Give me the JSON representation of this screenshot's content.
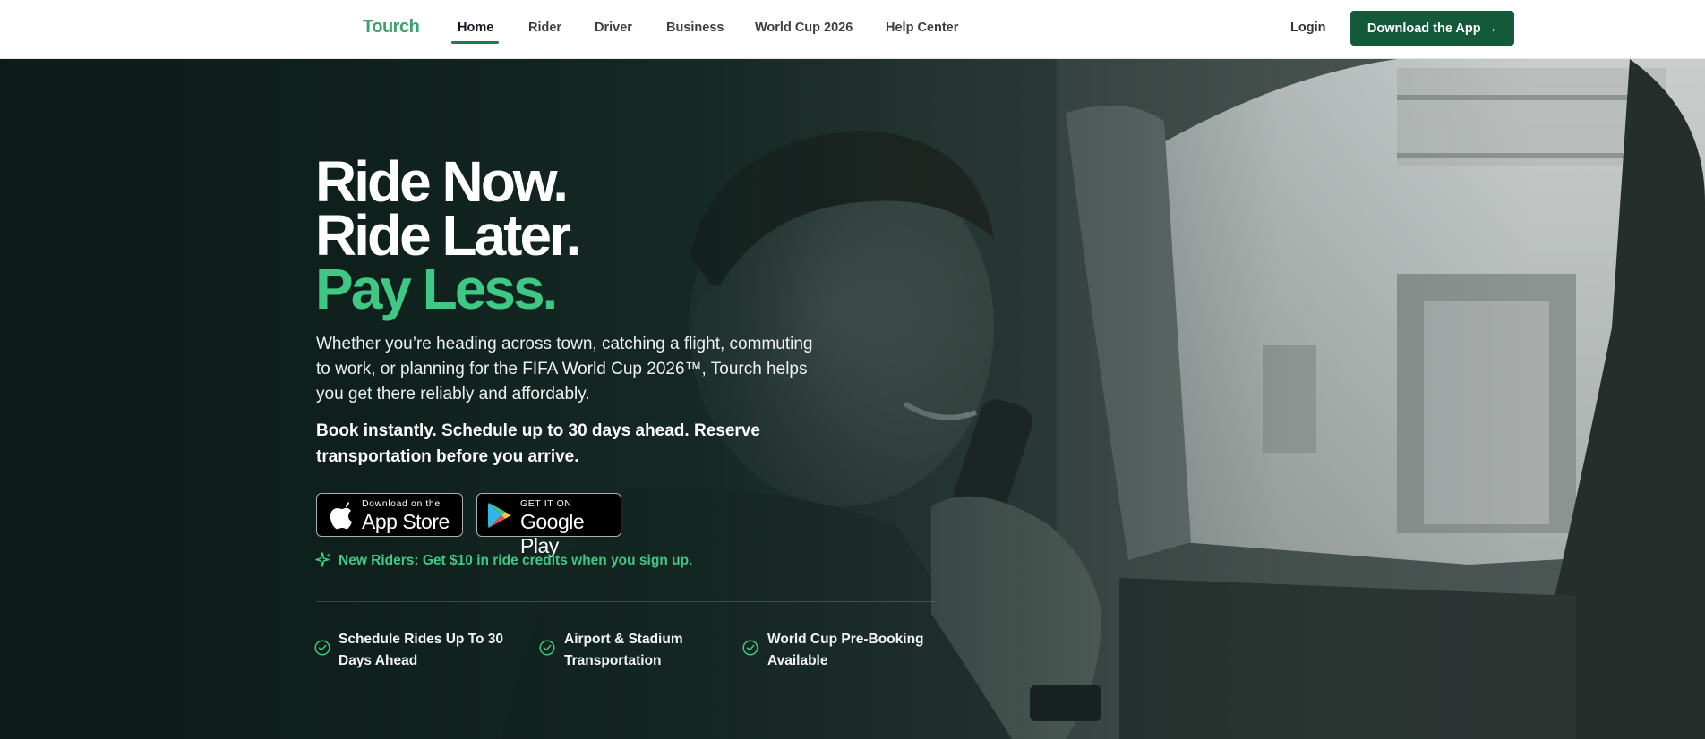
{
  "brand": {
    "logo": "Tourch"
  },
  "nav": {
    "links": [
      "Home",
      "Rider",
      "Driver",
      "Business",
      "World Cup 2026",
      "Help Center"
    ],
    "login": "Login",
    "cta": "Download the App →"
  },
  "hero": {
    "line1": "Ride Now.",
    "line2": "Ride Later.",
    "line3": "Pay Less.",
    "paragraph": "Whether you’re heading across town, catching a flight, commuting to work, or planning for the FIFA World Cup 2026™, Tourch helps you get there reliably and affordably.",
    "bold_paragraph": "Book instantly. Schedule up to 30 days ahead. Reserve transportation before you arrive.",
    "app_store": {
      "small": "Download on the",
      "big": "App Store"
    },
    "google_play": {
      "small": "GET IT ON",
      "big": "Google Play"
    },
    "promo": "New Riders: Get $10 in ride credits when you sign up.",
    "features": [
      {
        "line1": "Schedule Rides Up To 30",
        "line2": "Days Ahead"
      },
      {
        "line1": "Airport & Stadium",
        "line2": "Transportation"
      },
      {
        "line1": "World Cup Pre-Booking",
        "line2": "Available"
      }
    ]
  },
  "colors": {
    "accent": "#3ec883",
    "brand_dark": "#14593a",
    "logo": "#3aa36b"
  },
  "icons": [
    "apple-icon",
    "google-play-icon",
    "sparkle-icon",
    "check-circle-icon"
  ]
}
